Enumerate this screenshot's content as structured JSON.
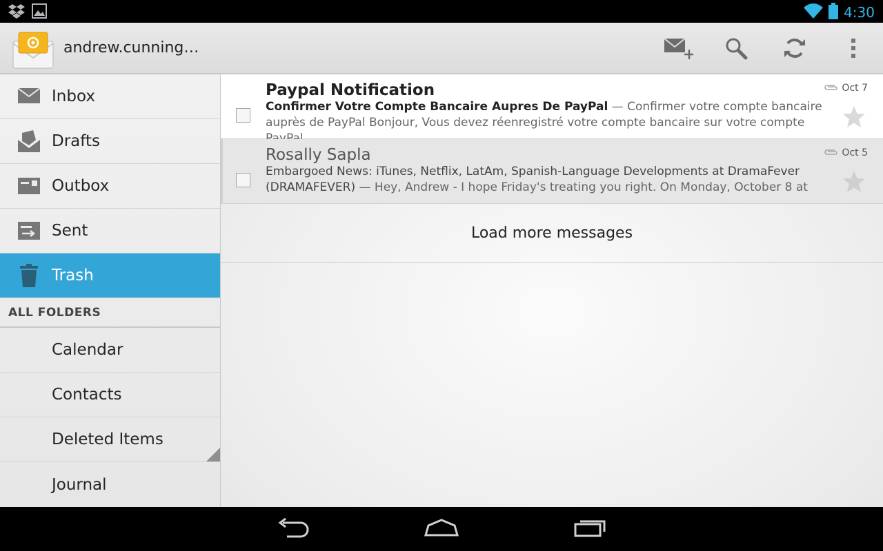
{
  "status_bar": {
    "time": "4:30",
    "icons": [
      "dropbox-icon",
      "gallery-icon",
      "wifi-icon",
      "battery-icon"
    ],
    "clock_color": "#33b5e5"
  },
  "action_bar": {
    "account": "andrew.cunning…",
    "actions": [
      "compose-icon",
      "search-icon",
      "refresh-icon",
      "overflow-menu-icon"
    ]
  },
  "sidebar": {
    "folders": [
      {
        "label": "Inbox",
        "icon": "inbox-icon"
      },
      {
        "label": "Drafts",
        "icon": "drafts-icon"
      },
      {
        "label": "Outbox",
        "icon": "outbox-icon"
      },
      {
        "label": "Sent",
        "icon": "sent-icon"
      },
      {
        "label": "Trash",
        "icon": "trash-icon",
        "selected": true
      }
    ],
    "all_folders_header": "ALL FOLDERS",
    "other_folders": [
      "Calendar",
      "Contacts",
      "Deleted Items",
      "Journal"
    ],
    "selected_color": "#33a6d7"
  },
  "messages": [
    {
      "sender": "Paypal Notification",
      "subject": "Confirmer Votre Compte Bancaire Aupres De PayPal",
      "snippet": " — Confirmer votre compte bancaire auprès de PayPal Bonjour, Vous devez réenregistré votre compte bancaire sur votre compte PayPal",
      "date": "Oct 7",
      "unread": true
    },
    {
      "sender": "Rosally Sapla",
      "subject": "Embargoed News: iTunes, Netflix, LatAm, Spanish-Language Developments at DramaFever (DRAMAFEVER)",
      "snippet": " — Hey, Andrew - I hope Friday's treating you right. On Monday, October 8 at",
      "date": "Oct 5",
      "unread": false
    }
  ],
  "load_more": "Load more messages",
  "nav_bar": [
    "back-icon",
    "home-icon",
    "recent-apps-icon"
  ]
}
